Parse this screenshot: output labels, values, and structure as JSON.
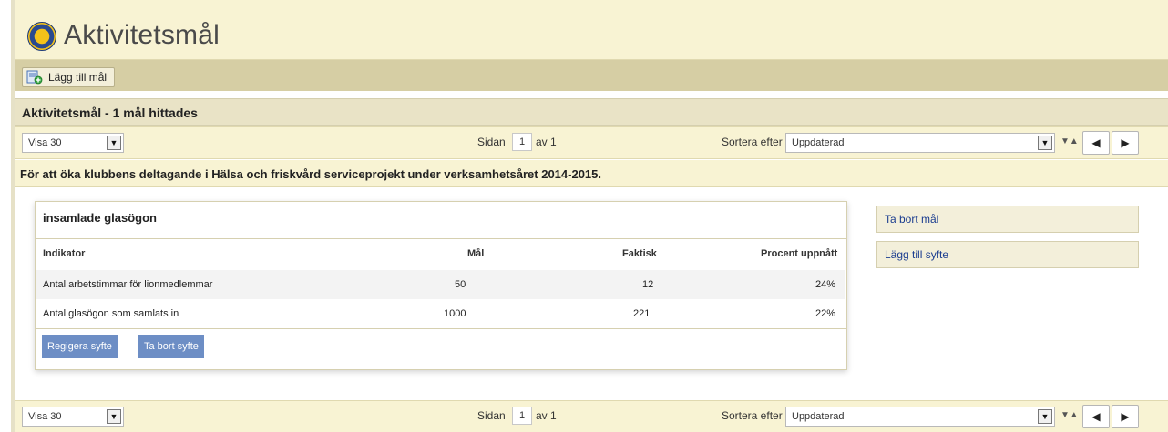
{
  "header": {
    "title": "Aktivitetsmål",
    "logo_icon": "lions-club-logo"
  },
  "toolbar": {
    "add_goal_label": "Lägg till mål",
    "add_goal_icon": "add-document-icon"
  },
  "results": {
    "count_text": "Aktivitetsmål - 1 mål hittades"
  },
  "pager": {
    "show_value": "Visa 30",
    "page_label": "Sidan",
    "page_number": "1",
    "page_of": "av 1",
    "sort_label": "Sortera efter",
    "sort_value": "Uppdaterad",
    "sort_toggle": "▼▲",
    "prev": "◀",
    "next": "▶",
    "dropdown_arrow": "▼"
  },
  "purpose": {
    "description": "För att öka klubbens deltagande i Hälsa och friskvård serviceprojekt under verksamhetsåret 2014-2015."
  },
  "goal_card": {
    "title": "insamlade glasögon",
    "columns": [
      "Indikator",
      "Mål",
      "Faktisk",
      "Procent uppnått"
    ],
    "rows": [
      {
        "indicator": "Antal arbetstimmar för lionmedlemmar",
        "goal": "50",
        "actual": "12",
        "percent": "24%"
      },
      {
        "indicator": "Antal glasögon som samlats in",
        "goal": "1000",
        "actual": "221",
        "percent": "22%"
      }
    ],
    "edit_button": "Regigera syfte",
    "remove_purpose_button": "Ta bort syfte"
  },
  "side_actions": {
    "remove_goal": "Ta bort mål",
    "add_purpose": "Lägg till syfte"
  },
  "colors": {
    "header_bg": "#f8f3d3",
    "toolbar_bg": "#d6cea4",
    "button_blue": "#6d8ec5",
    "link_blue": "#1a3c8f"
  }
}
